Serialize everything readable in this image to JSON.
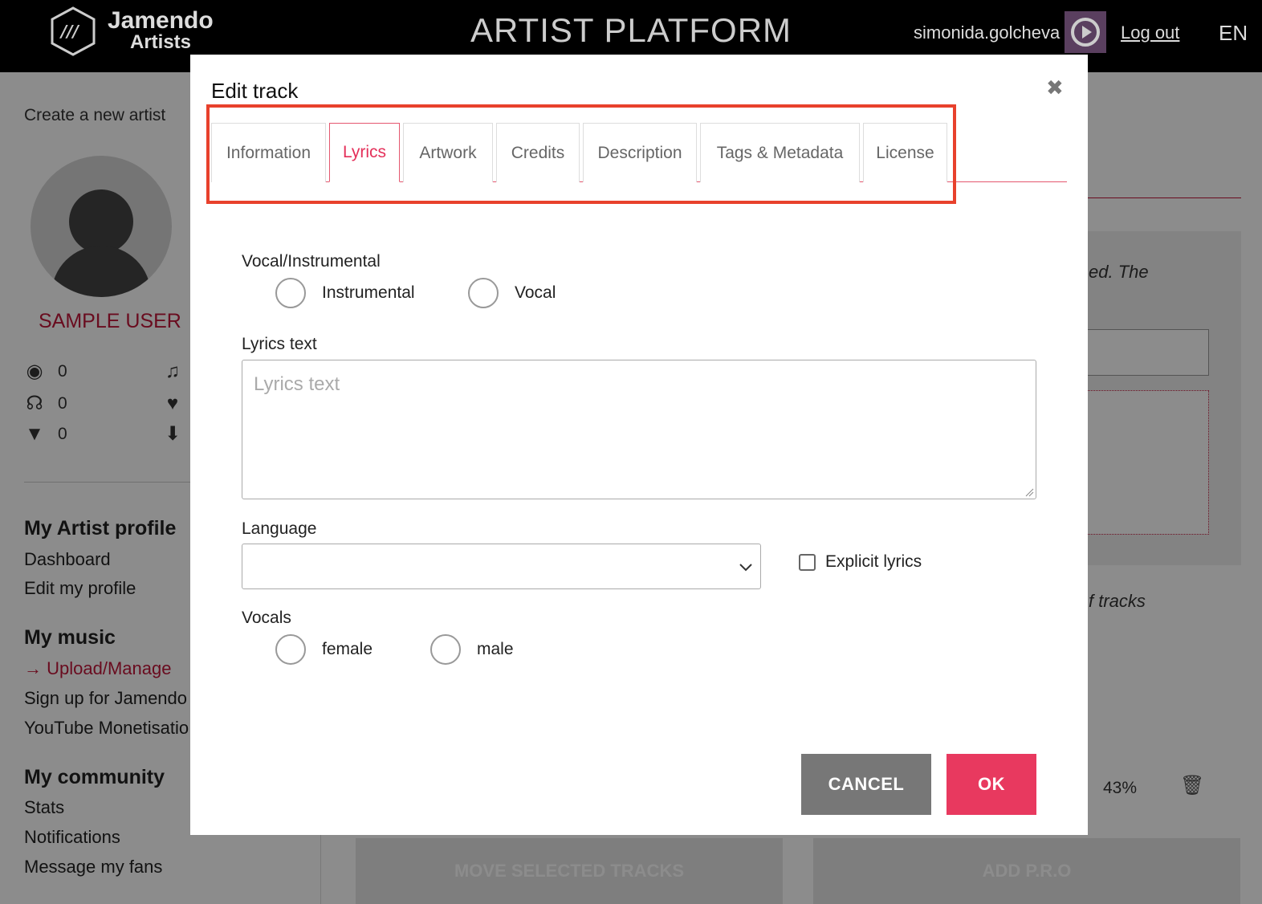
{
  "header": {
    "logo_name": "Jamendo",
    "logo_sub": "Artists",
    "platform_title": "ARTIST PLATFORM",
    "username": "simonida.golcheva",
    "logout_label": "Log out",
    "language": "EN"
  },
  "sidebar": {
    "create_artist": "Create a new artist",
    "user_name": "SAMPLE USER",
    "stats": [
      {
        "icon": "album-icon",
        "value": "0"
      },
      {
        "icon": "headphones-icon",
        "value": "0"
      },
      {
        "icon": "comment-icon",
        "value": "0"
      }
    ],
    "stat_icons_right": [
      "music-note-icon",
      "heart-icon",
      "download-icon"
    ],
    "sections": [
      {
        "title": "My Artist profile",
        "links": [
          "Dashboard",
          "Edit my profile"
        ]
      },
      {
        "title": "My music",
        "links": [
          "Upload/Manage",
          "Sign up for Jamendo",
          "YouTube Monetisatio"
        ]
      },
      {
        "title": "My community",
        "links": [
          "Stats",
          "Notifications",
          "Message my fans"
        ]
      }
    ],
    "active_arrow": "→"
  },
  "main": {
    "italic_1": "ed. The",
    "italic_2": "f tracks",
    "progress_percent": "43%",
    "move_tracks_label": "MOVE SELECTED TRACKS",
    "add_pro_label": "ADD P.R.O"
  },
  "modal": {
    "title": "Edit track",
    "close_glyph": "✖",
    "tabs": [
      "Information",
      "Lyrics",
      "Artwork",
      "Credits",
      "Description",
      "Tags & Metadata",
      "License"
    ],
    "active_tab": "Lyrics",
    "vocal_instrumental_label": "Vocal/Instrumental",
    "vocal_options": [
      "Instrumental",
      "Vocal"
    ],
    "lyrics_label": "Lyrics text",
    "lyrics_placeholder": "Lyrics text",
    "lyrics_value": "",
    "language_label": "Language",
    "language_value": "",
    "explicit_label": "Explicit lyrics",
    "explicit_checked": false,
    "vocals_label": "Vocals",
    "vocals_options": [
      "female",
      "male"
    ],
    "cancel_label": "CANCEL",
    "ok_label": "OK"
  },
  "colors": {
    "accent": "#e8395f",
    "active_tab": "#e4305a",
    "highlight_box": "#e8412c",
    "topbar": "#000000"
  }
}
